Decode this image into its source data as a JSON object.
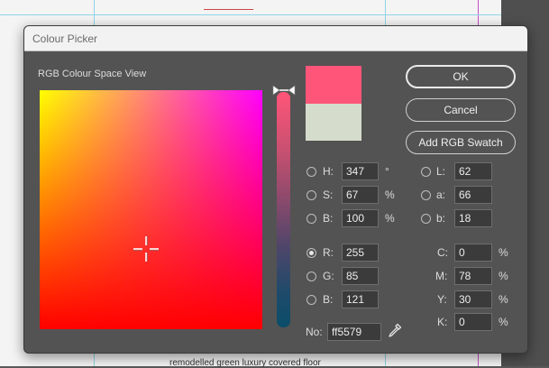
{
  "dialog": {
    "title": "Colour Picker",
    "section_label": "RGB Colour Space View",
    "new_color": "#ff5579",
    "old_color": "#d6dccc",
    "buttons": {
      "ok": "OK",
      "cancel": "Cancel",
      "add_swatch": "Add RGB Swatch"
    },
    "hsb": [
      {
        "label": "H:",
        "value": "347",
        "unit": "°",
        "selected": false
      },
      {
        "label": "S:",
        "value": "67",
        "unit": "%",
        "selected": false
      },
      {
        "label": "B:",
        "value": "100",
        "unit": "%",
        "selected": false
      }
    ],
    "lab": [
      {
        "label": "L:",
        "value": "62",
        "selected": false
      },
      {
        "label": "a:",
        "value": "66",
        "selected": false
      },
      {
        "label": "b:",
        "value": "18",
        "selected": false
      }
    ],
    "rgb": [
      {
        "label": "R:",
        "value": "255",
        "selected": true
      },
      {
        "label": "G:",
        "value": "85",
        "selected": false
      },
      {
        "label": "B:",
        "value": "121",
        "selected": false
      }
    ],
    "cmyk": [
      {
        "label": "C:",
        "value": "0",
        "unit": "%"
      },
      {
        "label": "M:",
        "value": "78",
        "unit": "%"
      },
      {
        "label": "Y:",
        "value": "30",
        "unit": "%"
      },
      {
        "label": "K:",
        "value": "0",
        "unit": "%"
      }
    ],
    "hex": {
      "label": "No:",
      "value": "ff5579"
    }
  },
  "background_doc": {
    "text": "remodelled green luxury covered floor"
  }
}
